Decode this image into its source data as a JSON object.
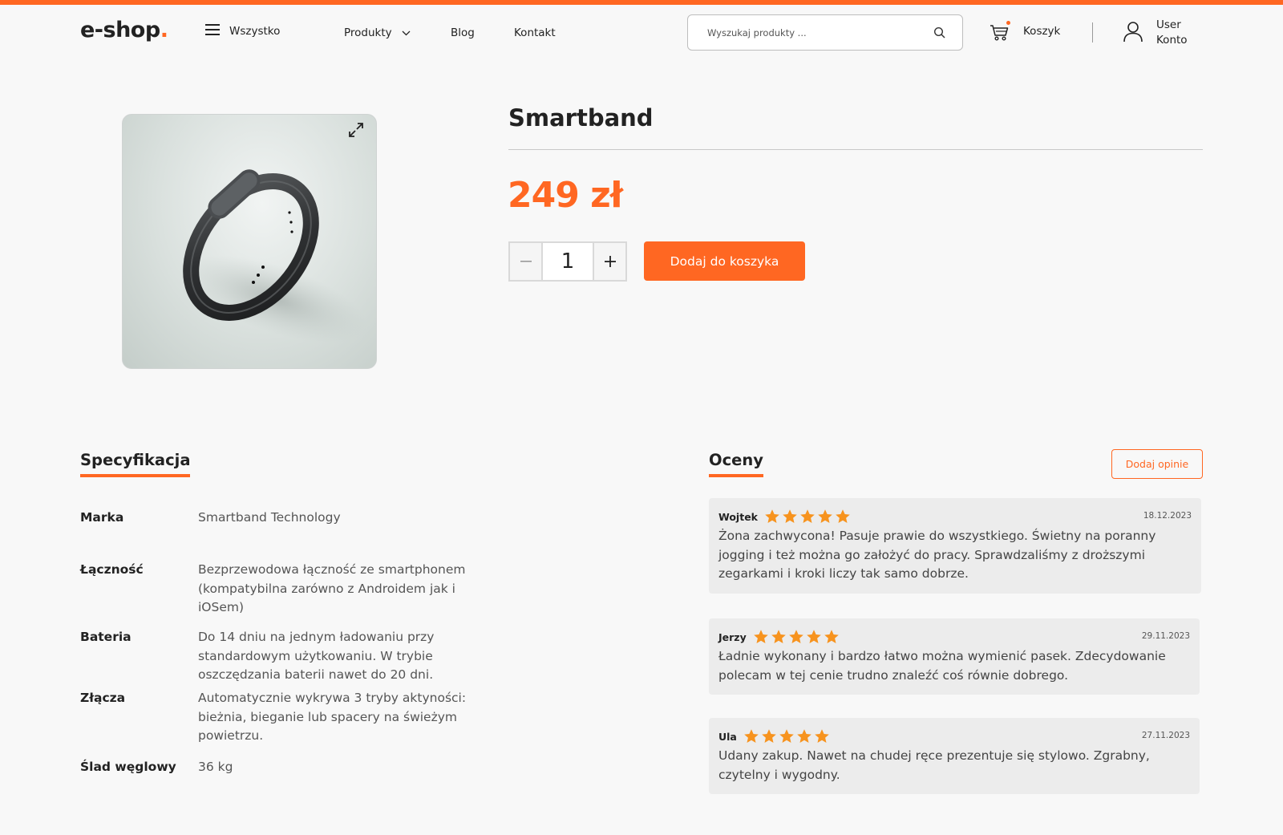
{
  "header": {
    "logo_text": "e-shop",
    "logo_dot": ".",
    "all_label": "Wszystko",
    "nav": {
      "products": "Produkty",
      "blog": "Blog",
      "contact": "Kontakt"
    },
    "search_placeholder": "Wyszukaj produkty ...",
    "cart_label": "Koszyk",
    "user_line1": "User",
    "user_line2": "Konto"
  },
  "product": {
    "title": "Smartband",
    "price": "249 zł",
    "quantity": "1",
    "add_to_cart": "Dodaj do koszyka"
  },
  "specs": {
    "title": "Specyfikacja",
    "rows": [
      {
        "key": "Marka",
        "value": "Smartband Technology"
      },
      {
        "key": "Łączność",
        "value": "Bezprzewodowa łączność ze smartphonem (kompatybilna zarówno z Androidem jak i iOSem)"
      },
      {
        "key": "Bateria",
        "value": "Do 14 dniu na jednym ładowaniu przy standardowym użytkowaniu. W trybie oszczędzania baterii nawet do 20 dni."
      },
      {
        "key": "Złącza",
        "value": "Automatycznie wykrywa 3 tryby aktyności: bieżnia, bieganie lub spacery na świeżym powietrzu."
      },
      {
        "key": "Ślad węglowy",
        "value": "36 kg"
      }
    ]
  },
  "reviews": {
    "title": "Oceny",
    "add_label": "Dodaj opinie",
    "items": [
      {
        "name": "Wojtek",
        "rating": 5,
        "date": "18.12.2023",
        "text": "Żona zachwycona! Pasuje prawie do wszystkiego. Świetny na poranny jogging i też można go założyć do pracy. Sprawdzaliśmy z droższymi zegarkami i kroki liczy tak samo dobrze."
      },
      {
        "name": "Jerzy",
        "rating": 5,
        "date": "29.11.2023",
        "text": "Ładnie wykonany i bardzo łatwo można wymienić pasek. Zdecydowanie polecam w tej cenie trudno znaleźć coś równie dobrego."
      },
      {
        "name": "Ula",
        "rating": 5,
        "date": "27.11.2023",
        "text": "Udany zakup. Nawet na chudej ręce prezentuje się stylowo. Zgrabny, czytelny i wygodny."
      }
    ]
  },
  "colors": {
    "accent": "#ff6722",
    "star": "#f7931e",
    "background": "#f8f8f8"
  },
  "icons": [
    "hamburger-icon",
    "chevron-down-icon",
    "search-icon",
    "cart-icon",
    "user-icon",
    "expand-icon",
    "star-icon",
    "minus-icon",
    "plus-icon"
  ]
}
